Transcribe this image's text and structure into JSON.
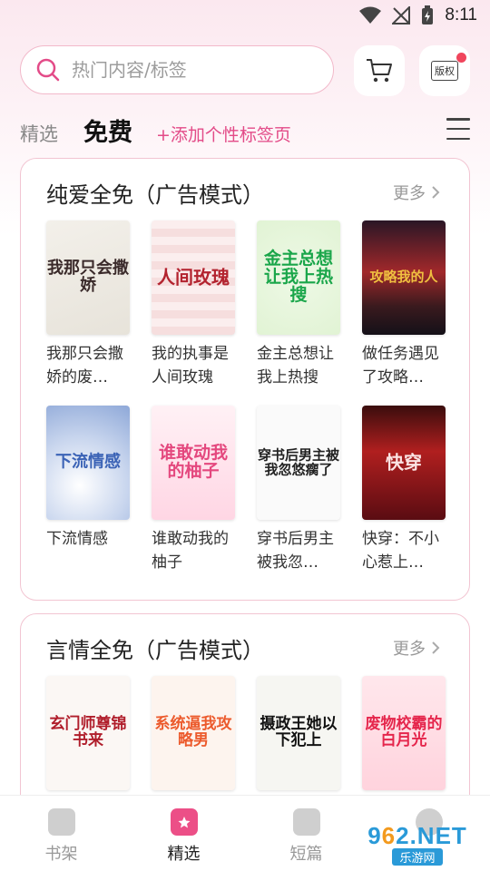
{
  "status_bar": {
    "time": "8:11"
  },
  "search": {
    "placeholder": "热门内容/标签"
  },
  "header": {
    "copyright_label": "版权"
  },
  "tabs": {
    "select": "精选",
    "free": "免费",
    "add": "+添加个性标签页"
  },
  "section1": {
    "title": "纯爱全免（广告模式）",
    "more": "更多",
    "books": [
      {
        "title": "我那只会撒娇的废…",
        "cover_text": "我那只会撒娇"
      },
      {
        "title": "我的执事是人间玫瑰",
        "cover_text": "人间玫瑰"
      },
      {
        "title": "金主总想让我上热搜",
        "cover_text": "金主总想让我上热搜"
      },
      {
        "title": "做任务遇见了攻略…",
        "cover_text": "攻略我的人"
      },
      {
        "title": "下流情感",
        "cover_text": "下流情感"
      },
      {
        "title": "谁敢动我的柚子",
        "cover_text": "谁敢动我的柚子"
      },
      {
        "title": "穿书后男主被我忽…",
        "cover_text": "穿书后男主被我忽悠瘸了"
      },
      {
        "title": "快穿：不小心惹上…",
        "cover_text": "快穿"
      }
    ]
  },
  "section2": {
    "title": "言情全免（广告模式）",
    "more": "更多",
    "books": [
      {
        "title": "",
        "cover_text": "玄门师尊锦书来"
      },
      {
        "title": "",
        "cover_text": "系统逼我攻略男"
      },
      {
        "title": "",
        "cover_text": "摄政王她以下犯上"
      },
      {
        "title": "",
        "cover_text": "废物校霸的白月光"
      }
    ]
  },
  "bottom_nav": [
    {
      "label": "书架"
    },
    {
      "label": "精选"
    },
    {
      "label": "短篇"
    },
    {
      "label": ""
    }
  ],
  "watermark": {
    "main_a": "9",
    "main_o": "6",
    "main_b": "2.NET",
    "sub": "乐游网"
  },
  "colors": {
    "accent": "#ec4f87",
    "tab_add": "#e34b88",
    "border": "#f2c5d2"
  }
}
